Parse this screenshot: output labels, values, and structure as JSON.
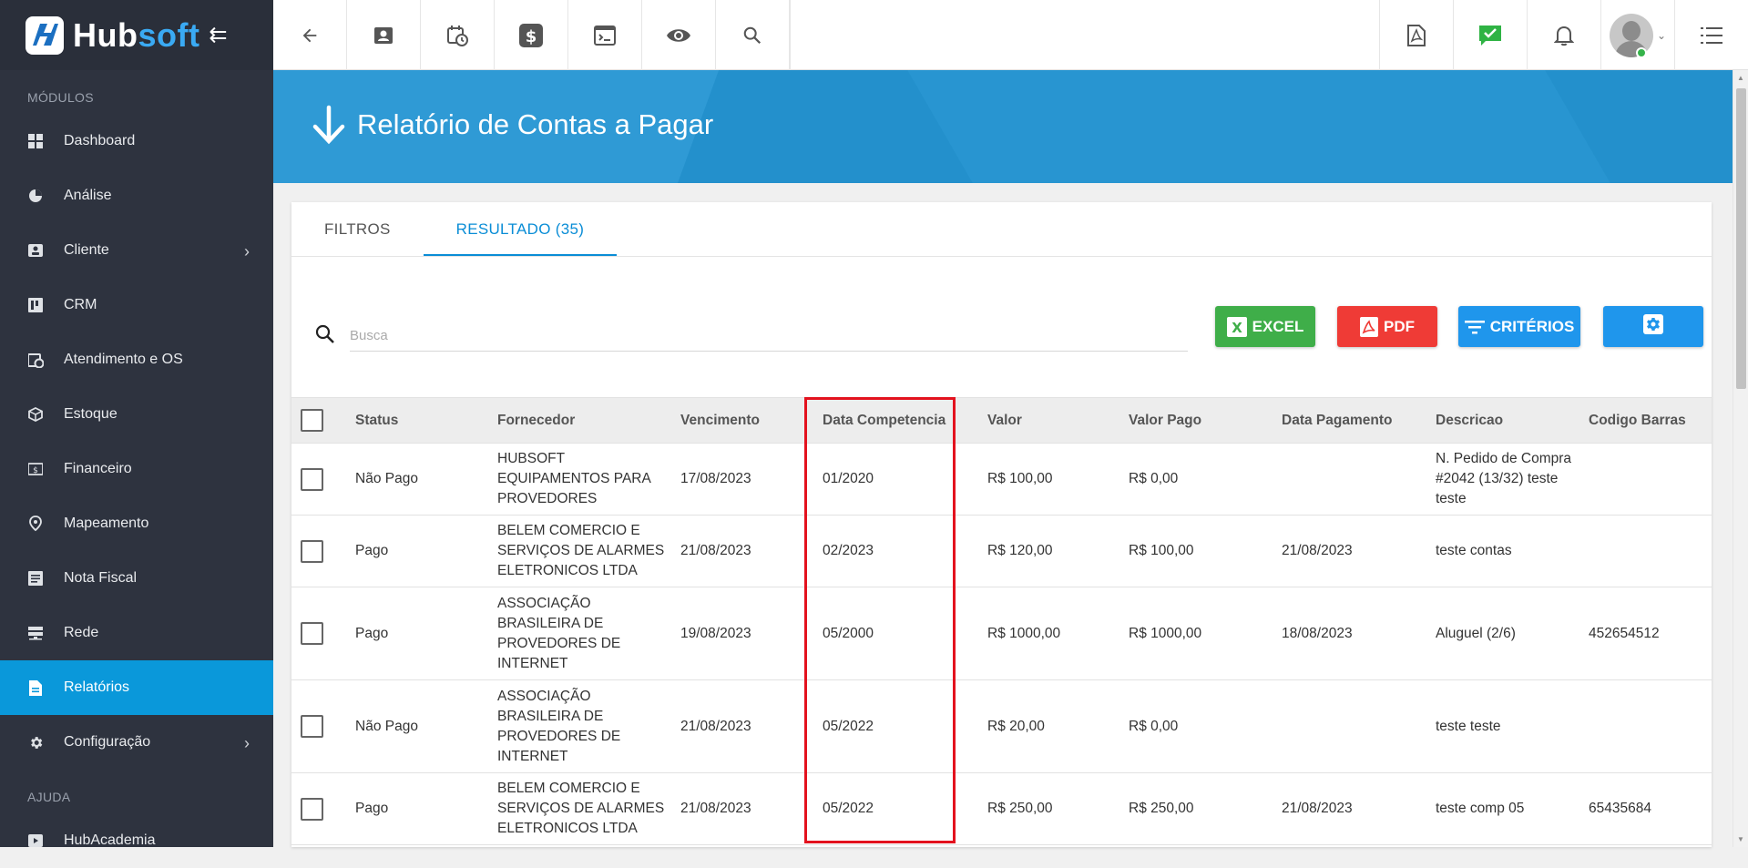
{
  "app": {
    "logo_hub": "Hub",
    "logo_soft": "soft"
  },
  "sidebar": {
    "section_modules": "MÓDULOS",
    "section_help": "AJUDA",
    "items": [
      {
        "label": "Dashboard",
        "icon": "dashboard-icon"
      },
      {
        "label": "Análise",
        "icon": "pie-chart-icon"
      },
      {
        "label": "Cliente",
        "icon": "contact-card-icon",
        "has_children": true
      },
      {
        "label": "CRM",
        "icon": "kanban-icon"
      },
      {
        "label": "Atendimento e OS",
        "icon": "calendar-clock-icon"
      },
      {
        "label": "Estoque",
        "icon": "box-icon"
      },
      {
        "label": "Financeiro",
        "icon": "money-icon"
      },
      {
        "label": "Mapeamento",
        "icon": "map-pin-icon"
      },
      {
        "label": "Nota Fiscal",
        "icon": "invoice-icon"
      },
      {
        "label": "Rede",
        "icon": "server-icon"
      },
      {
        "label": "Relatórios",
        "icon": "report-icon",
        "active": true
      },
      {
        "label": "Configuração",
        "icon": "gear-icon",
        "has_children": true
      }
    ],
    "help_items": [
      {
        "label": "HubAcademia",
        "icon": "play-icon"
      }
    ]
  },
  "topbar": {
    "left_icons": [
      "back-arrow-icon",
      "contact-card-icon",
      "calendar-clock-icon",
      "dollar-icon",
      "terminal-icon",
      "eye-icon",
      "search-icon"
    ],
    "right_icons": [
      "pdf-file-icon",
      "check-chat-icon",
      "bell-icon",
      "avatar",
      "list-menu-icon"
    ]
  },
  "page": {
    "title": "Relatório de Contas a Pagar"
  },
  "tabs": [
    {
      "label": "FILTROS",
      "active": false
    },
    {
      "label": "RESULTADO (35)",
      "active": true
    }
  ],
  "toolbar": {
    "search_placeholder": "Busca",
    "excel_label": "EXCEL",
    "pdf_label": "PDF",
    "criteria_label": "CRITÉRIOS"
  },
  "colors": {
    "sidebar_bg": "#2e333f",
    "active_blue": "#0a98da",
    "header_band": "#2390cc",
    "excel_green": "#3fae49",
    "pdf_red": "#ef3b36",
    "button_blue": "#1f96ec",
    "highlight_red": "#e3121e"
  },
  "table": {
    "columns": [
      "Status",
      "Fornecedor",
      "Vencimento",
      "Data Competencia",
      "Valor",
      "Valor Pago",
      "Data Pagamento",
      "Descricao",
      "Codigo Barras"
    ],
    "rows": [
      {
        "status": "Não Pago",
        "fornecedor": "HUBSOFT EQUIPAMENTOS PARA PROVEDORES",
        "vencimento": "17/08/2023",
        "competencia": "01/2020",
        "valor": "R$ 100,00",
        "valor_pago": "R$ 0,00",
        "data_pagamento": "",
        "descricao": "N. Pedido de Compra #2042 (13/32) teste teste",
        "codigo_barras": ""
      },
      {
        "status": "Pago",
        "fornecedor": "BELEM COMERCIO E SERVIÇOS DE ALARMES ELETRONICOS LTDA",
        "vencimento": "21/08/2023",
        "competencia": "02/2023",
        "valor": "R$ 120,00",
        "valor_pago": "R$ 100,00",
        "data_pagamento": "21/08/2023",
        "descricao": "teste contas",
        "codigo_barras": ""
      },
      {
        "status": "Pago",
        "fornecedor": "ASSOCIAÇÃO BRASILEIRA DE PROVEDORES DE INTERNET",
        "vencimento": "19/08/2023",
        "competencia": "05/2000",
        "valor": "R$ 1000,00",
        "valor_pago": "R$ 1000,00",
        "data_pagamento": "18/08/2023",
        "descricao": "Aluguel (2/6)",
        "codigo_barras": "452654512"
      },
      {
        "status": "Não Pago",
        "fornecedor": "ASSOCIAÇÃO BRASILEIRA DE PROVEDORES DE INTERNET",
        "vencimento": "21/08/2023",
        "competencia": "05/2022",
        "valor": "R$ 20,00",
        "valor_pago": "R$ 0,00",
        "data_pagamento": "",
        "descricao": "teste teste",
        "codigo_barras": ""
      },
      {
        "status": "Pago",
        "fornecedor": "BELEM COMERCIO E SERVIÇOS DE ALARMES ELETRONICOS LTDA",
        "vencimento": "21/08/2023",
        "competencia": "05/2022",
        "valor": "R$ 250,00",
        "valor_pago": "R$ 250,00",
        "data_pagamento": "21/08/2023",
        "descricao": "teste comp 05",
        "codigo_barras": "65435684"
      }
    ]
  }
}
